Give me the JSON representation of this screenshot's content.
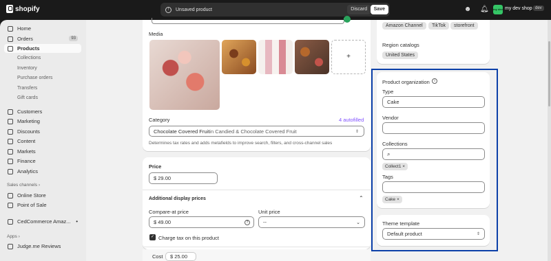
{
  "topbar": {
    "brand": "shopify",
    "unsaved_text": "Unsaved product",
    "discard_label": "Discard",
    "save_label": "Save",
    "store_badge": "my dev",
    "store_name": "my dev shop",
    "store_env": "dev"
  },
  "sidebar": {
    "items": [
      {
        "label": "Home",
        "icon": "home-icon"
      },
      {
        "label": "Orders",
        "icon": "orders-icon",
        "badge": "93"
      },
      {
        "label": "Products",
        "icon": "tag-icon"
      },
      {
        "label": "Customers",
        "icon": "person-icon"
      },
      {
        "label": "Marketing",
        "icon": "target-icon"
      },
      {
        "label": "Discounts",
        "icon": "discount-icon"
      },
      {
        "label": "Content",
        "icon": "content-icon"
      },
      {
        "label": "Markets",
        "icon": "globe-icon"
      },
      {
        "label": "Finance",
        "icon": "bank-icon"
      },
      {
        "label": "Analytics",
        "icon": "chart-icon"
      }
    ],
    "product_sub": [
      "Collections",
      "Inventory",
      "Purchase orders",
      "Transfers",
      "Gift cards"
    ],
    "sales_channels_label": "Sales channels",
    "channels": [
      {
        "label": "Online Store",
        "icon": "store-icon"
      },
      {
        "label": "Point of Sale",
        "icon": "pos-icon"
      },
      {
        "label": "CedCommerce Amaz...",
        "icon": "app-icon"
      }
    ],
    "apps_label": "Apps",
    "apps": [
      {
        "label": "Judge.me Reviews",
        "icon": "judgeme-icon"
      }
    ]
  },
  "media": {
    "label": "Media",
    "add_label": "+"
  },
  "category": {
    "label": "Category",
    "autofilled": "4 autofilled",
    "value_bold": "Chocolate Covered Fruit",
    "value_rest": " in Candied & Chocolate Covered Fruit",
    "help": "Determines tax rates and adds metafields to improve search, filters, and cross-channel sales"
  },
  "pricing": {
    "price_label": "Price",
    "currency": "$",
    "price": "29.00",
    "additional_label": "Additional display prices",
    "compare_label": "Compare-at price",
    "compare_value": "49.00",
    "unit_label": "Unit price",
    "unit_value": "--",
    "tax_label": "Charge tax on this product",
    "cost_label": "Cost",
    "cost_value": "$ 25.00"
  },
  "channels_card": {
    "chips": [
      "Amazon Channel",
      "TikTok",
      "storefront"
    ],
    "region_label": "Region catalogs",
    "region_chip": "United States"
  },
  "org": {
    "title": "Product organization",
    "type_label": "Type",
    "type_value": "Cake",
    "vendor_label": "Vendor",
    "vendor_value": "",
    "collections_label": "Collections",
    "collection_tag": "Collect1",
    "tags_label": "Tags",
    "tag": "Cake"
  },
  "theme": {
    "label": "Theme template",
    "value": "Default product"
  },
  "colors": {
    "highlight": "#0b3fa8",
    "autofill": "#8051ff",
    "store_badge": "#35c566"
  }
}
